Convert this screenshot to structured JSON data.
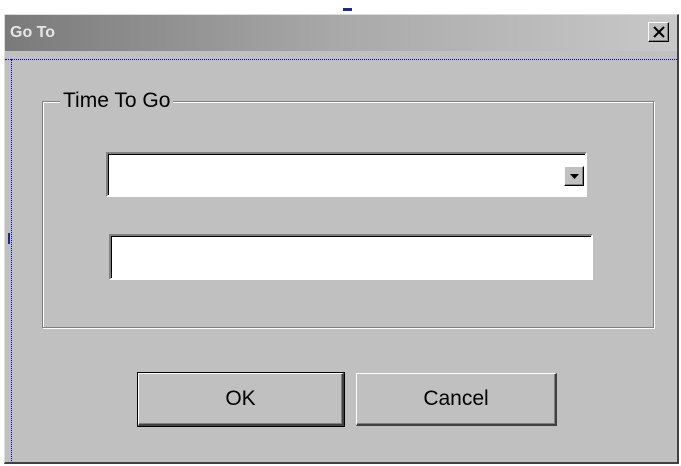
{
  "window": {
    "title": "Go To",
    "close_symbol": "×"
  },
  "group": {
    "label": "Time To Go"
  },
  "combo": {
    "value": ""
  },
  "textfield": {
    "value": ""
  },
  "buttons": {
    "ok_label": "OK",
    "cancel_label": "Cancel"
  },
  "icons": {
    "close": "close-icon",
    "dropdown": "chevron-down-icon"
  },
  "colors": {
    "dialog_face": "#c0c0c0",
    "titlebar_dark": "#7a7a7a",
    "titlebar_light": "#c8c8c8",
    "focus_dots": "#0000c8"
  }
}
